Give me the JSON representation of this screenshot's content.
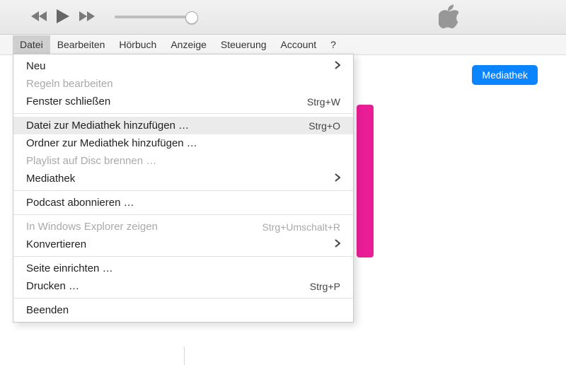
{
  "menubar": [
    "Datei",
    "Bearbeiten",
    "Hörbuch",
    "Anzeige",
    "Steuerung",
    "Account",
    "?"
  ],
  "dropdown": [
    {
      "label": "Neu",
      "submenu": true
    },
    {
      "label": "Regeln bearbeiten",
      "disabled": true
    },
    {
      "label": "Fenster schließen",
      "shortcut": "Strg+W"
    },
    {
      "sep": true
    },
    {
      "label": "Datei zur Mediathek hinzufügen …",
      "shortcut": "Strg+O",
      "hover": true
    },
    {
      "label": "Ordner zur Mediathek hinzufügen …"
    },
    {
      "label": "Playlist auf Disc brennen …",
      "disabled": true
    },
    {
      "label": "Mediathek",
      "submenu": true
    },
    {
      "sep": true
    },
    {
      "label": "Podcast abonnieren …"
    },
    {
      "sep": true
    },
    {
      "label": "In Windows Explorer zeigen",
      "shortcut": "Strg+Umschalt+R",
      "disabled": true
    },
    {
      "label": "Konvertieren",
      "submenu": true
    },
    {
      "sep": true
    },
    {
      "label": "Seite einrichten …"
    },
    {
      "label": "Drucken …",
      "shortcut": "Strg+P"
    },
    {
      "sep": true
    },
    {
      "label": "Beenden"
    }
  ],
  "rightButton": "Mediathek"
}
